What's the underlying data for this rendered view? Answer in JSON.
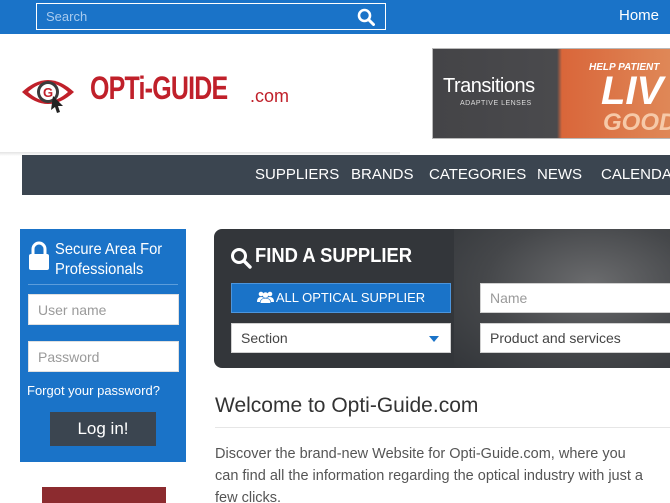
{
  "topbar": {
    "search_placeholder": "Search",
    "home_label": "Home"
  },
  "logo": {
    "name": "OPTi-GUIDE",
    "suffix": ".com",
    "brand_color": "#c0202a"
  },
  "ad_banner": {
    "brand": "Transitions",
    "tagline": "ADAPTIVE LENSES",
    "help_text": "HELP PATIENT",
    "live_text": "LIV",
    "good_text": "GOOD"
  },
  "nav": {
    "items": [
      "SUPPLIERS",
      "BRANDS",
      "CATEGORIES",
      "NEWS",
      "CALENDA"
    ]
  },
  "login": {
    "title": "Secure Area For Professionals",
    "username_placeholder": "User name",
    "password_placeholder": "Password",
    "forgot_label": "Forgot your password?",
    "login_label": "Log in!"
  },
  "finder": {
    "title": "FIND A SUPPLIER",
    "all_supplier_label": "ALL OPTICAL SUPPLIER",
    "name_placeholder": "Name",
    "section_value": "Section",
    "product_value": "Product and services"
  },
  "small_ad": {
    "close_label": "✕"
  },
  "welcome": {
    "title": "Welcome to Opti-Guide.com",
    "text": "Discover the brand-new Website for Opti-Guide.com, where you can find all the information regarding the optical industry with just a few clicks."
  },
  "colors": {
    "accent": "#1a73c8",
    "nav_bg": "#3b4550",
    "finder_bg": "#33363a"
  }
}
